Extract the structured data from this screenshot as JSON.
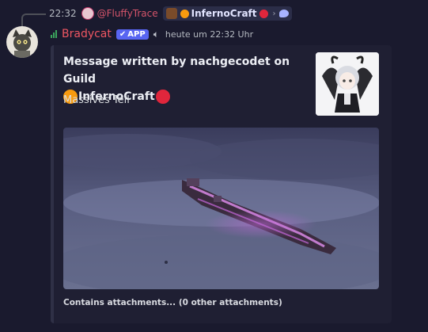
{
  "reply": {
    "time": "22:32",
    "mention": "@FluffyTrace",
    "guild": "InfernoCraft",
    "chevron": "›"
  },
  "message": {
    "username": "Bradycat",
    "badge": "APP",
    "timestamp": "heute um 22:32 Uhr",
    "username_color": "#ee5662",
    "badge_color": "#5865f2"
  },
  "embed": {
    "title_line1": "Message written by nachgecodet on Guild",
    "title_guild": "InfernoCraft",
    "description": "Massives Teil",
    "footer": "Contains attachments... (0 other attachments)"
  },
  "icons": {
    "reply_avatar": "pink-avatar-icon",
    "guild": "guild-icon",
    "thread": "speech-bubble-icon",
    "signal": "signal-bars-icon",
    "badge_check": "checkmark-icon",
    "speaker": "speaker-icon"
  },
  "colors": {
    "orange_dot": "#f79a0f",
    "red_dot": "#e0263c",
    "background": "#1a1a2e"
  }
}
